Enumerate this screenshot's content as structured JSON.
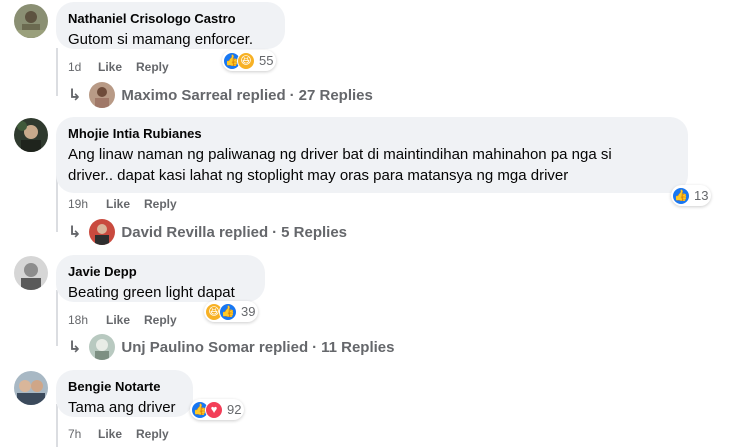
{
  "comments": [
    {
      "author": "Nathaniel Crisologo Castro",
      "text": "Gutom si mamang enforcer.",
      "time": "1d",
      "like_label": "Like",
      "reply_label": "Reply",
      "reactions": [
        "like",
        "haha"
      ],
      "reaction_count": "55",
      "replies": {
        "name": "Maximo Sarreal replied",
        "sep": "·",
        "count_label": "27 Replies"
      }
    },
    {
      "author": "Mhojie Intia Rubianes",
      "text_line1": "Ang linaw naman ng paliwanag ng driver bat di maintindihan mahinahon pa nga si",
      "text_line2": "driver.. dapat kasi lahat ng stoplight may oras para matansya ng mga driver",
      "time": "19h",
      "like_label": "Like",
      "reply_label": "Reply",
      "reactions": [
        "like"
      ],
      "reaction_count": "13",
      "replies": {
        "name": "David Revilla replied",
        "sep": "·",
        "count_label": "5 Replies"
      }
    },
    {
      "author": "Javie Depp",
      "text": "Beating green light dapat",
      "time": "18h",
      "like_label": "Like",
      "reply_label": "Reply",
      "reactions": [
        "haha",
        "like"
      ],
      "reaction_count": "39",
      "replies": {
        "name": "Unj Paulino Somar replied",
        "sep": "·",
        "count_label": "11 Replies"
      }
    },
    {
      "author": "Bengie Notarte",
      "text": "Tama ang driver",
      "time": "7h",
      "like_label": "Like",
      "reply_label": "Reply",
      "reactions": [
        "like",
        "love"
      ],
      "reaction_count": "92"
    }
  ],
  "colors": {
    "bubble": "#f0f2f5",
    "meta_text": "#65676b",
    "like_blue": "#1877f2",
    "haha_yellow": "#f7b125",
    "love_red": "#f33e58"
  },
  "icons": {
    "reply_arrow": "↳",
    "like": "thumbs-up-icon",
    "haha": "laughing-face-icon",
    "love": "heart-icon"
  }
}
